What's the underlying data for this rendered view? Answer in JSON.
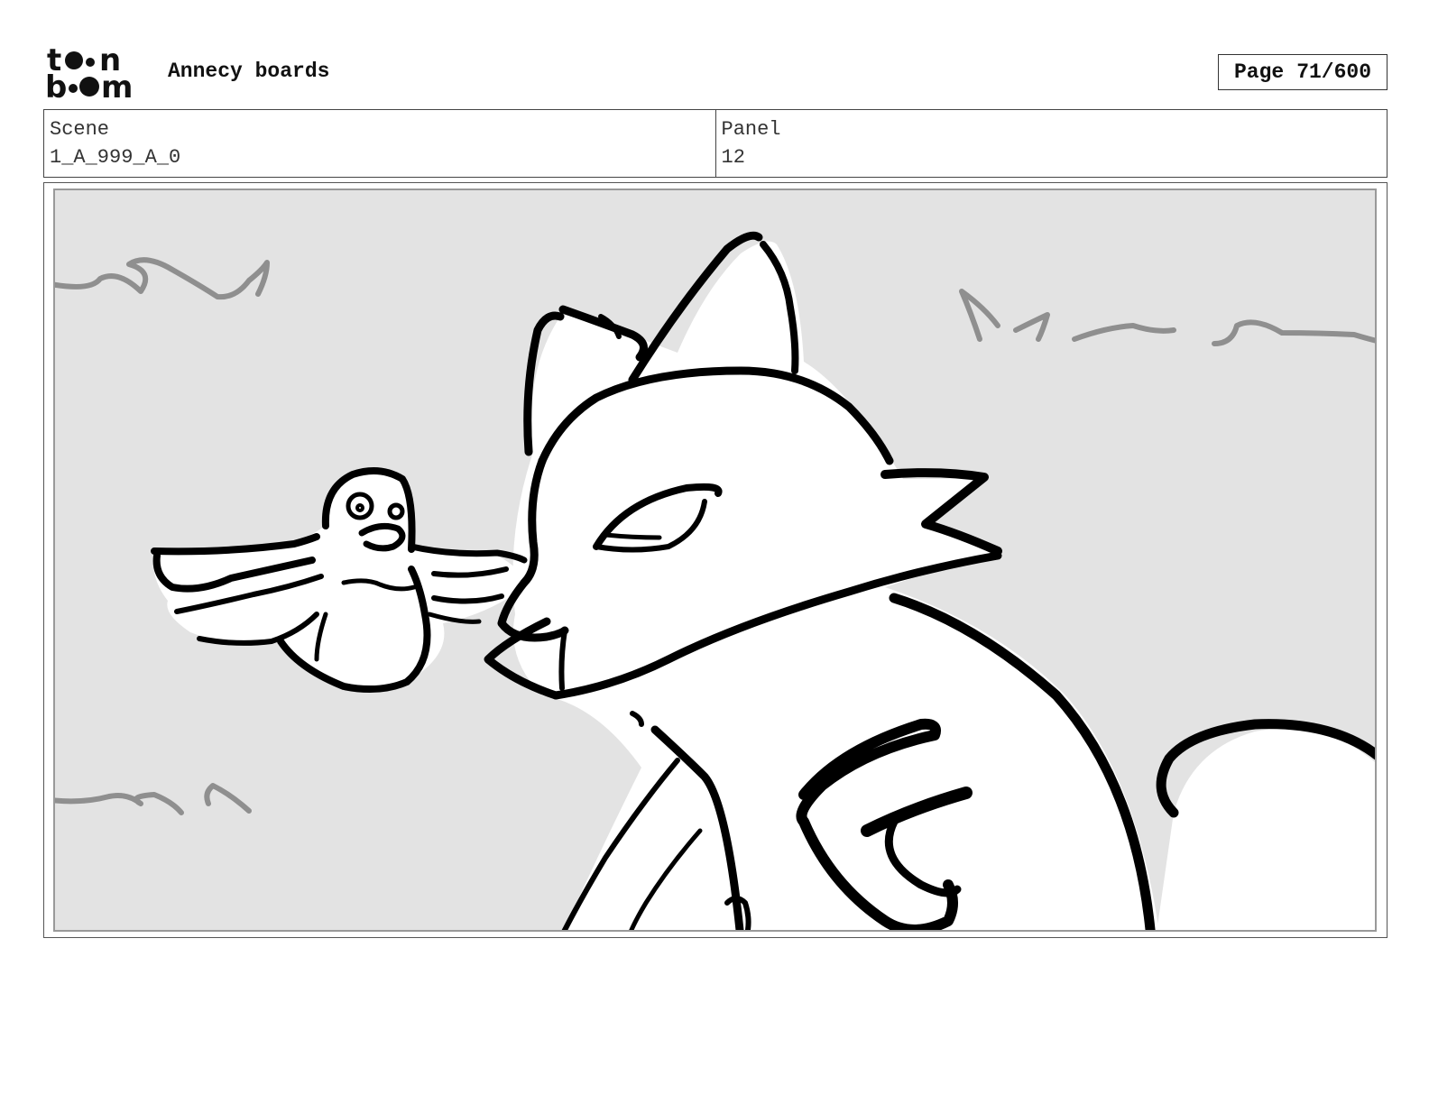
{
  "header": {
    "logo": {
      "line1": "toon",
      "line2": "boom"
    },
    "title": "Annecy boards",
    "page_label": "Page",
    "page_value": "71/600"
  },
  "info": {
    "scene_label": "Scene",
    "scene_value": "1_A_999_A_0",
    "panel_label": "Panel",
    "panel_value": "12"
  },
  "colors": {
    "sky": "#e3e3e3",
    "ink": "#000000",
    "cloud_stroke": "#8f8f8f",
    "frame": "#555555"
  }
}
